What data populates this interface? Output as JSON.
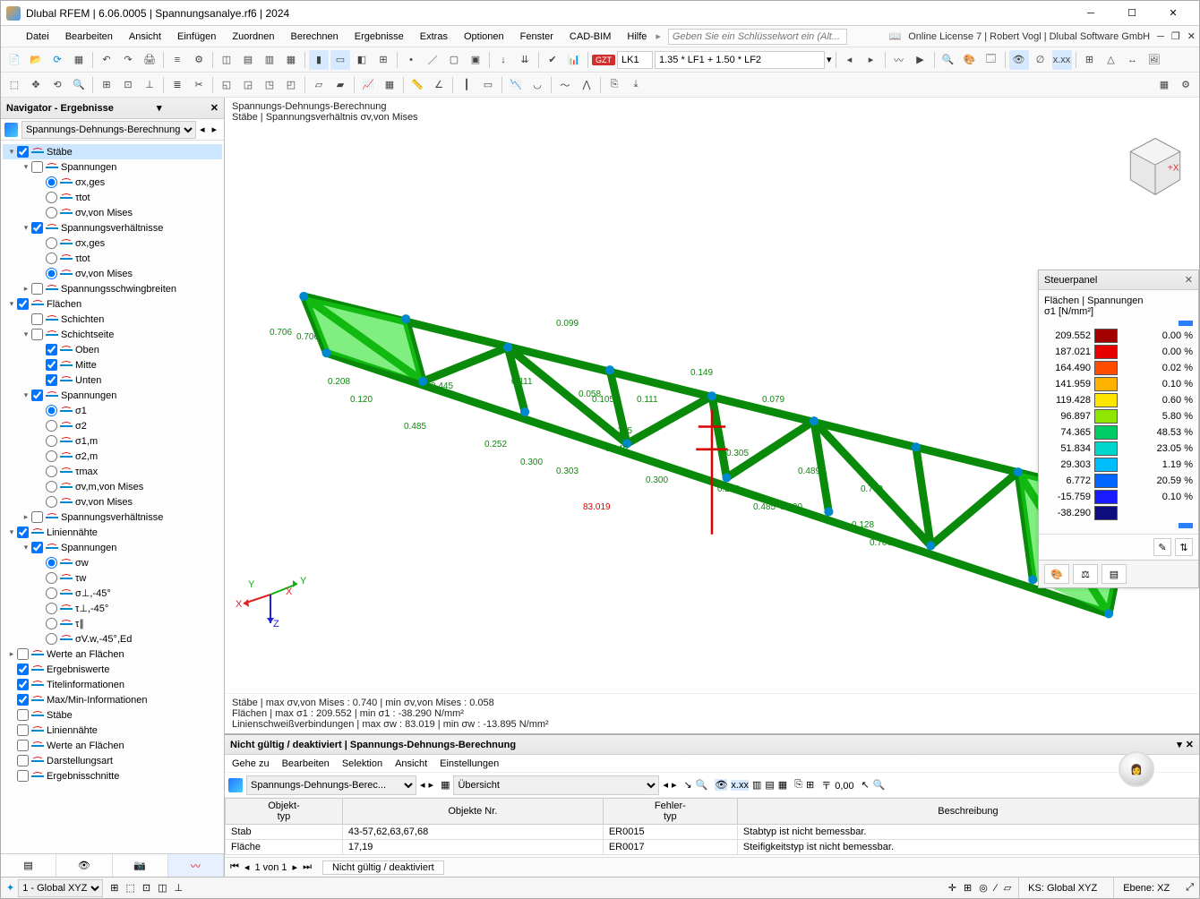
{
  "title": "Dlubal RFEM | 6.06.0005 | Spannungsanalye.rf6 | 2024",
  "menu": [
    "Datei",
    "Bearbeiten",
    "Ansicht",
    "Einfügen",
    "Zuordnen",
    "Berechnen",
    "Ergebnisse",
    "Extras",
    "Optionen",
    "Fenster",
    "CAD-BIM",
    "Hilfe"
  ],
  "search_placeholder": "Geben Sie ein Schlüsselwort ein (Alt...",
  "license": "Online License 7 | Robert Vogl | Dlubal Software GmbH",
  "load_combo": {
    "badge": "GZT",
    "lk": "LK1",
    "formula": "1.35 * LF1 + 1.50 * LF2"
  },
  "navigator": {
    "title": "Navigator - Ergebnisse",
    "combo": "Spannungs-Dehnungs-Berechnung",
    "tree": [
      {
        "d": 0,
        "t": "group",
        "e": "▾",
        "c": true,
        "l": "Stäbe",
        "sel": true,
        "ico": "m"
      },
      {
        "d": 1,
        "t": "group",
        "e": "▾",
        "c": false,
        "l": "Spannungen",
        "ico": "s"
      },
      {
        "d": 2,
        "t": "radio",
        "r": true,
        "l": "σx,ges",
        "ico": "sx"
      },
      {
        "d": 2,
        "t": "radio",
        "r": false,
        "l": "τtot",
        "ico": "t"
      },
      {
        "d": 2,
        "t": "radio",
        "r": false,
        "l": "σv,von Mises",
        "ico": "sv"
      },
      {
        "d": 1,
        "t": "group",
        "e": "▾",
        "c": true,
        "l": "Spannungsverhältnisse",
        "ico": "r"
      },
      {
        "d": 2,
        "t": "radio",
        "r": false,
        "l": "σx,ges",
        "ico": "sx"
      },
      {
        "d": 2,
        "t": "radio",
        "r": false,
        "l": "τtot",
        "ico": "t"
      },
      {
        "d": 2,
        "t": "radio",
        "r": true,
        "l": "σv,von Mises",
        "ico": "sv"
      },
      {
        "d": 1,
        "t": "group",
        "e": "▸",
        "c": false,
        "l": "Spannungsschwingbreiten",
        "ico": "w"
      },
      {
        "d": 0,
        "t": "group",
        "e": "▾",
        "c": true,
        "l": "Flächen",
        "ico": "f"
      },
      {
        "d": 1,
        "t": "leaf",
        "c": false,
        "l": "Schichten",
        "ico": "ly"
      },
      {
        "d": 1,
        "t": "group",
        "e": "▾",
        "c": false,
        "l": "Schichtseite",
        "ico": "ls"
      },
      {
        "d": 2,
        "t": "leaf",
        "c": true,
        "l": "Oben",
        "ico": "o"
      },
      {
        "d": 2,
        "t": "leaf",
        "c": true,
        "l": "Mitte",
        "ico": "mi"
      },
      {
        "d": 2,
        "t": "leaf",
        "c": true,
        "l": "Unten",
        "ico": "u"
      },
      {
        "d": 1,
        "t": "group",
        "e": "▾",
        "c": true,
        "l": "Spannungen",
        "ico": "s"
      },
      {
        "d": 2,
        "t": "radio",
        "r": true,
        "l": "σ1",
        "ico": "sv"
      },
      {
        "d": 2,
        "t": "radio",
        "r": false,
        "l": "σ2",
        "ico": "sv"
      },
      {
        "d": 2,
        "t": "radio",
        "r": false,
        "l": "σ1,m",
        "ico": "sv"
      },
      {
        "d": 2,
        "t": "radio",
        "r": false,
        "l": "σ2,m",
        "ico": "sv"
      },
      {
        "d": 2,
        "t": "radio",
        "r": false,
        "l": "τmax",
        "ico": "t"
      },
      {
        "d": 2,
        "t": "radio",
        "r": false,
        "l": "σv,m,von Mises",
        "ico": "sv"
      },
      {
        "d": 2,
        "t": "radio",
        "r": false,
        "l": "σv,von Mises",
        "ico": "sv"
      },
      {
        "d": 1,
        "t": "group",
        "e": "▸",
        "c": false,
        "l": "Spannungsverhältnisse",
        "ico": "r"
      },
      {
        "d": 0,
        "t": "group",
        "e": "▾",
        "c": true,
        "l": "Liniennähte",
        "ico": "ln"
      },
      {
        "d": 1,
        "t": "group",
        "e": "▾",
        "c": true,
        "l": "Spannungen",
        "ico": "s"
      },
      {
        "d": 2,
        "t": "radio",
        "r": true,
        "l": "σw",
        "ico": "sv"
      },
      {
        "d": 2,
        "t": "radio",
        "r": false,
        "l": "τw",
        "ico": "t"
      },
      {
        "d": 2,
        "t": "radio",
        "r": false,
        "l": "σ⊥,-45°",
        "ico": "sv"
      },
      {
        "d": 2,
        "t": "radio",
        "r": false,
        "l": "τ⊥,-45°",
        "ico": "t"
      },
      {
        "d": 2,
        "t": "radio",
        "r": false,
        "l": "τ∥",
        "ico": "t"
      },
      {
        "d": 2,
        "t": "radio",
        "r": false,
        "l": "σV.w,-45°,Ed",
        "ico": "sv"
      },
      {
        "d": 0,
        "t": "group",
        "e": "▸",
        "c": false,
        "l": "Werte an Flächen",
        "ico": "wf"
      },
      {
        "d": 0,
        "t": "leaf",
        "c": true,
        "l": "Ergebniswerte",
        "ico": "ev",
        "xx": true
      },
      {
        "d": 0,
        "t": "leaf",
        "c": true,
        "l": "Titelinformationen",
        "ico": "ti"
      },
      {
        "d": 0,
        "t": "leaf",
        "c": true,
        "l": "Max/Min-Informationen",
        "ico": "mm"
      },
      {
        "d": 0,
        "t": "leaf",
        "c": false,
        "l": "Stäbe",
        "ico": "m"
      },
      {
        "d": 0,
        "t": "leaf",
        "c": false,
        "l": "Liniennähte",
        "ico": "ln"
      },
      {
        "d": 0,
        "t": "leaf",
        "c": false,
        "l": "Werte an Flächen",
        "ico": "wf"
      },
      {
        "d": 0,
        "t": "leaf",
        "c": false,
        "l": "Darstellungsart",
        "ico": "da"
      },
      {
        "d": 0,
        "t": "leaf",
        "c": false,
        "l": "Ergebnisschnitte",
        "ico": "es"
      }
    ]
  },
  "viewport": {
    "title1": "Spannungs-Dehnungs-Berechnung",
    "title2": "Stäbe | Spannungsverhältnis σv,von Mises",
    "footer1": "Stäbe | max σv,von Mises : 0.740 | min σv,von Mises : 0.058",
    "footer2": "Flächen | max σ1 : 209.552 | min σ1 : -38.290 N/mm²",
    "footer3": "Linienschweißverbindungen | max σw : 83.019 | min σw : -13.895 N/mm²",
    "labels": [
      "0.706",
      "0.120",
      "0.485",
      "0.252",
      "0.300",
      "0.303",
      "0.058",
      "0.105",
      "83.019",
      "0.300",
      "0.111",
      "0.252",
      "0.305",
      "0.489",
      "0.149",
      "0.079",
      "0.485",
      "0.130",
      "0.709",
      "0.128",
      "0.706",
      "0.099",
      "0.111",
      "0.208",
      "0.706",
      "0.140",
      "0.445",
      "0.105"
    ]
  },
  "steuer": {
    "title": "Steuerpanel",
    "section": "Flächen | Spannungen",
    "unit": "σ1 [N/mm²]",
    "legend": [
      {
        "v": "209.552",
        "c": "#a30000",
        "p": "0.00 %"
      },
      {
        "v": "187.021",
        "c": "#e60000",
        "p": "0.00 %"
      },
      {
        "v": "164.490",
        "c": "#ff4d00",
        "p": "0.02 %"
      },
      {
        "v": "141.959",
        "c": "#ffb300",
        "p": "0.10 %"
      },
      {
        "v": "119.428",
        "c": "#ffe600",
        "p": "0.60 %"
      },
      {
        "v": "96.897",
        "c": "#8fe600",
        "p": "5.80 %"
      },
      {
        "v": "74.365",
        "c": "#00cc66",
        "p": "48.53 %"
      },
      {
        "v": "51.834",
        "c": "#00d6cc",
        "p": "23.05 %"
      },
      {
        "v": "29.303",
        "c": "#00bfff",
        "p": "1.19 %"
      },
      {
        "v": "6.772",
        "c": "#0066ff",
        "p": "20.59 %"
      },
      {
        "v": "-15.759",
        "c": "#1a1aff",
        "p": "0.10 %"
      },
      {
        "v": "-38.290",
        "c": "#0d0d80",
        "p": ""
      }
    ]
  },
  "bottom": {
    "title": "Nicht gültig / deaktiviert | Spannungs-Dehnungs-Berechnung",
    "menu": [
      "Gehe zu",
      "Bearbeiten",
      "Selektion",
      "Ansicht",
      "Einstellungen"
    ],
    "combo1": "Spannungs-Dehnungs-Berec...",
    "combo2": "Übersicht",
    "headers": [
      "Objekt-\ntyp",
      "Objekte Nr.",
      "Fehler-\ntyp",
      "Beschreibung"
    ],
    "rows": [
      {
        "typ": "Stab",
        "nr": "43-57,62,63,67,68",
        "err": "ER0015",
        "desc": "Stabtyp ist nicht bemessbar."
      },
      {
        "typ": "Fläche",
        "nr": "17,19",
        "err": "ER0017",
        "desc": "Steifigkeitstyp ist nicht bemessbar."
      }
    ],
    "pager": "1 von 1",
    "tab": "Nicht gültig / deaktiviert"
  },
  "status": {
    "cs": "1 - Global XYZ",
    "ks": "KS: Global XYZ",
    "ebene": "Ebene: XZ"
  }
}
